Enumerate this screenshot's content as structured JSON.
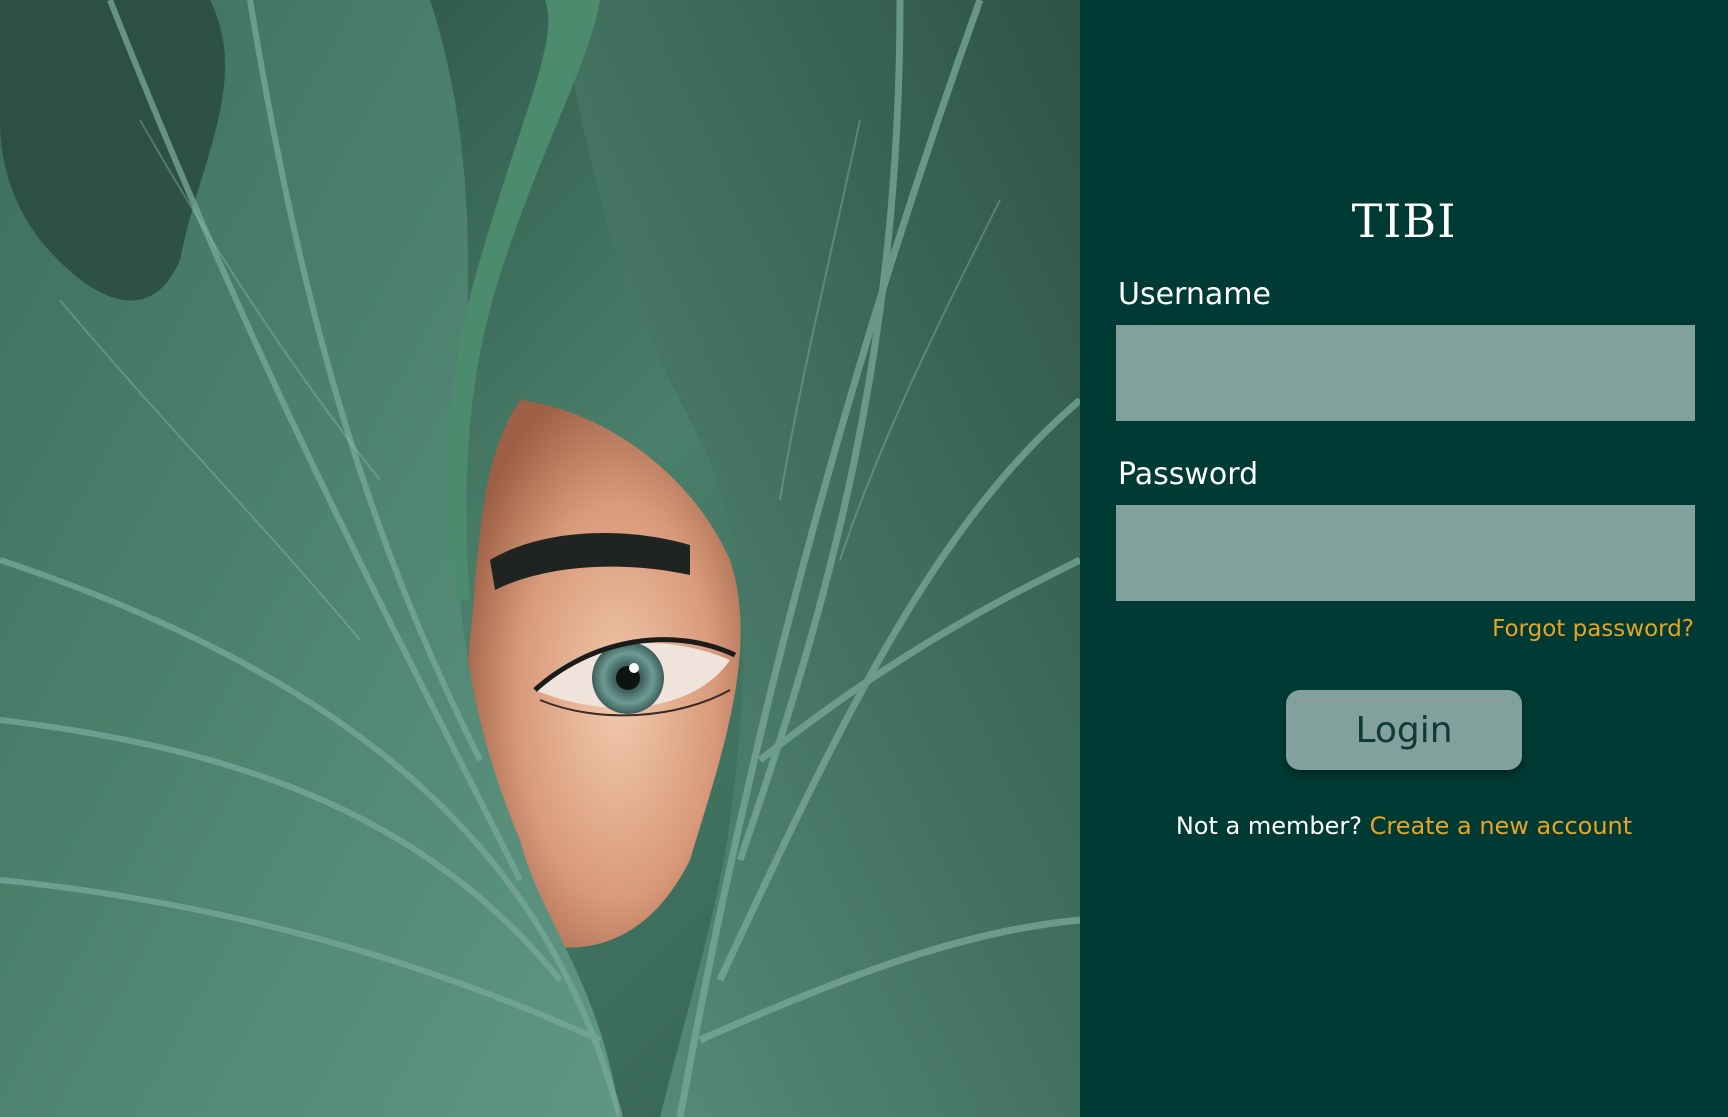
{
  "hero": {
    "image_description_name": "leaf-eye-photo"
  },
  "brand": {
    "title": "TIBI"
  },
  "form": {
    "username_label": "Username",
    "username_value": "",
    "password_label": "Password",
    "password_value": "",
    "forgot_password": "Forgot password?",
    "login_label": "Login"
  },
  "signup": {
    "prompt": "Not a member?",
    "link": "Create a new account"
  },
  "colors": {
    "panel_background": "#003a34",
    "input_background": "#82a19c",
    "accent": "#eaa221",
    "text": "#ffffff"
  }
}
